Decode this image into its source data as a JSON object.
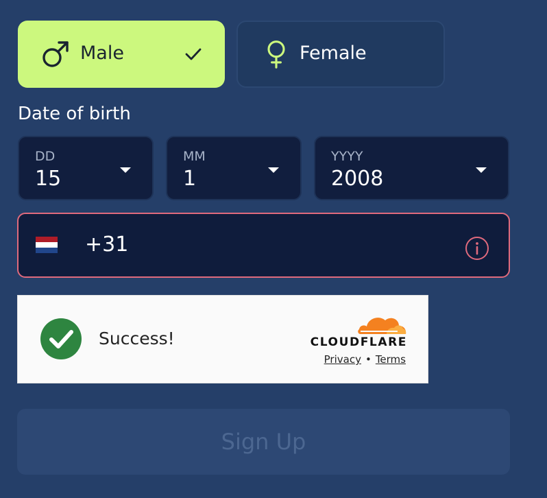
{
  "gender": {
    "male_label": "Male",
    "female_label": "Female",
    "selected": "male"
  },
  "dob": {
    "label": "Date of birth",
    "day": {
      "caption": "DD",
      "value": "15"
    },
    "month": {
      "caption": "MM",
      "value": "1"
    },
    "year": {
      "caption": "YYYY",
      "value": "2008"
    }
  },
  "phone": {
    "country_flag": "netherlands-flag",
    "value": "+31",
    "status": "error"
  },
  "captcha": {
    "status_text": "Success!",
    "brand": "CLOUDFLARE",
    "privacy_link": "Privacy",
    "separator": "•",
    "terms_link": "Terms"
  },
  "signup": {
    "label": "Sign Up",
    "state": "disabled"
  },
  "colors": {
    "background": "#253f69",
    "male_selected": "#ccf87e",
    "female_icon": "#ccf87e",
    "error_border": "#e06a7d",
    "success_green": "#2e8540",
    "cloudflare_orange": "#f48120"
  }
}
